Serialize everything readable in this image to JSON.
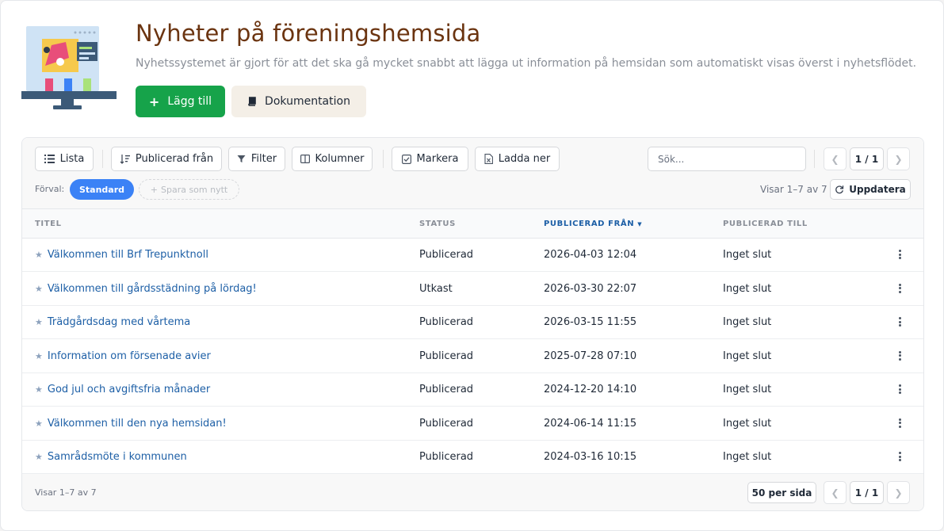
{
  "header": {
    "title": "Nyheter på föreningshemsida",
    "subtitle": "Nyhetssystemet är gjort för att det ska gå mycket snabbt att lägga ut information på hemsidan som automatiskt visas överst i nyhetsflödet.",
    "add_label": "Lägg till",
    "add_icon": "plus-icon",
    "docs_label": "Dokumentation",
    "docs_icon": "book-icon"
  },
  "toolbar": {
    "list_label": "Lista",
    "sort_label": "Publicerad från",
    "filter_label": "Filter",
    "columns_label": "Kolumner",
    "select_label": "Markera",
    "download_label": "Ladda ner",
    "search_placeholder": "Sök...",
    "page_indicator": "1 / 1"
  },
  "presets": {
    "label": "Förval:",
    "active": "Standard",
    "save_label": "Spara som nytt"
  },
  "status": {
    "showing": "Visar 1–7 av 7",
    "refresh_label": "Uppdatera"
  },
  "table": {
    "columns": [
      "TITEL",
      "STATUS",
      "PUBLICERAD FRÅN",
      "PUBLICERAD TILL"
    ],
    "sorted_column": "PUBLICERAD FRÅN",
    "rows": [
      {
        "title": "Välkommen till Brf Trepunktnoll",
        "status": "Publicerad",
        "from": "2026-04-03 12:04",
        "to": "Inget slut"
      },
      {
        "title": "Välkommen till gårdsstädning på lördag!",
        "status": "Utkast",
        "from": "2026-03-30 22:07",
        "to": "Inget slut"
      },
      {
        "title": "Trädgårdsdag med vårtema",
        "status": "Publicerad",
        "from": "2026-03-15 11:55",
        "to": "Inget slut"
      },
      {
        "title": "Information om försenade avier",
        "status": "Publicerad",
        "from": "2025-07-28 07:10",
        "to": "Inget slut"
      },
      {
        "title": "God jul och avgiftsfria månader",
        "status": "Publicerad",
        "from": "2024-12-20 14:10",
        "to": "Inget slut"
      },
      {
        "title": "Välkommen till den nya hemsidan!",
        "status": "Publicerad",
        "from": "2024-06-14 11:15",
        "to": "Inget slut"
      },
      {
        "title": "Samrådsmöte i kommunen",
        "status": "Publicerad",
        "from": "2024-03-16 10:15",
        "to": "Inget slut"
      }
    ]
  },
  "footer": {
    "showing": "Visar 1–7 av 7",
    "per_page": "50 per sida",
    "page_indicator": "1 / 1"
  },
  "colors": {
    "title": "#6b3410",
    "primary_button": "#16a34a",
    "docs_button": "#f4efe7",
    "link": "#1d5fa6",
    "active_chip": "#3b82f6"
  }
}
